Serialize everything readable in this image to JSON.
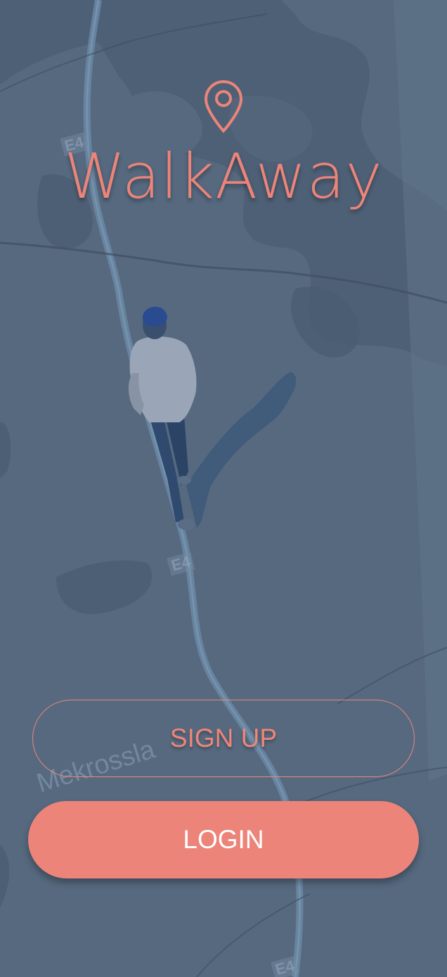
{
  "app": {
    "title": "WalkAway"
  },
  "icons": {
    "logo": "map-pin-icon"
  },
  "map": {
    "road_labels": [
      "E4",
      "E4",
      "E4"
    ],
    "place_label": "Mekrossla"
  },
  "actions": {
    "signup_label": "SIGN UP",
    "login_label": "LOGIN"
  },
  "colors": {
    "accent": "#ec8479",
    "background": "#56697f",
    "text_on_accent": "#ffffff"
  }
}
